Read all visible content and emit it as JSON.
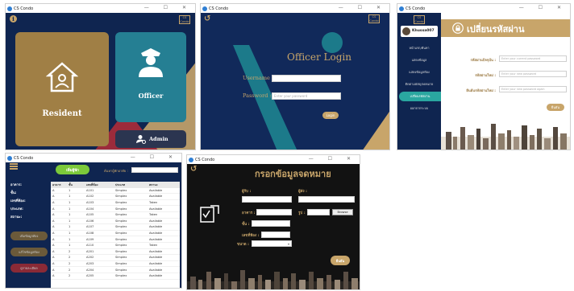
{
  "app_name": "CS Condo",
  "window_controls": "— ☐ ✕",
  "win1": {
    "resident_label": "Resident",
    "officer_label": "Officer",
    "admin_label": "Admin",
    "logo": "CS Condo"
  },
  "win2": {
    "title": "Officer Login",
    "username_label": "Username :",
    "password_label": "Password :",
    "password_placeholder": "Enter your password",
    "login_button": "Login",
    "logo": "CS Condo"
  },
  "win3": {
    "page_title": "เปลี่ยนรหัสผ่าน",
    "username": "Khussa007",
    "logo": "CS Condo",
    "menu": [
      "หน้าแรก/ค้นหา",
      "แสดงข้อมูล",
      "แสดงข้อมูลห้อง",
      "ติดตามพัสดุ/จดหมาย",
      "เปลี่ยนรหัสผ่าน",
      "ออกจากระบบ"
    ],
    "old_password_label": "รหัสผ่านปัจจุบัน :",
    "old_password_placeholder": "Enter your current password",
    "new_password_label": "รหัสผ่านใหม่ :",
    "new_password_placeholder": "Enter your new password",
    "confirm_label": "ยืนยันรหัสผ่านใหม่ :",
    "confirm_placeholder": "Enter your new password again",
    "submit_button": "ยืนยัน"
  },
  "win4": {
    "filter_labels": [
      "อาคาร:",
      "ชั้น:",
      "เลขที่ห้อง:",
      "ประเภท:",
      "สถานะ:"
    ],
    "add_button": "เพิ่มผู้พัก",
    "search_label": "ค้นหาผู้พักอาศัย :",
    "side_buttons": [
      "เพิ่มข้อมูลห้อง",
      "แก้ไขข้อมูลห้อง",
      "ดูรายละเอียด"
    ],
    "columns": [
      "อาคาร",
      "ชั้น",
      "เลขที่ห้อง",
      "ประเภท",
      "สถานะ"
    ],
    "rows": [
      [
        "A",
        "1",
        "A101",
        "Simplex",
        "Available"
      ],
      [
        "A",
        "1",
        "A102",
        "Simplex",
        "Available"
      ],
      [
        "A",
        "1",
        "A103",
        "Simplex",
        "Taken"
      ],
      [
        "A",
        "1",
        "A104",
        "Simplex",
        "Available"
      ],
      [
        "A",
        "1",
        "A105",
        "Simplex",
        "Taken"
      ],
      [
        "A",
        "1",
        "A106",
        "Simplex",
        "Available"
      ],
      [
        "A",
        "1",
        "A107",
        "Simplex",
        "Available"
      ],
      [
        "A",
        "1",
        "A108",
        "Simplex",
        "Available"
      ],
      [
        "A",
        "1",
        "A109",
        "Simplex",
        "Available"
      ],
      [
        "A",
        "1",
        "A110",
        "Simplex",
        "Taken"
      ],
      [
        "A",
        "2",
        "A201",
        "Simplex",
        "Available"
      ],
      [
        "A",
        "2",
        "A202",
        "Simplex",
        "Available"
      ],
      [
        "A",
        "2",
        "A203",
        "Simplex",
        "Available"
      ],
      [
        "A",
        "2",
        "A204",
        "Simplex",
        "Available"
      ],
      [
        "A",
        "2",
        "A205",
        "Simplex",
        "Available"
      ]
    ]
  },
  "win5": {
    "title": "กรอกข้อมูลจดหมาย",
    "to_label": "ผู้รับ :",
    "building_label": "อาคาร :",
    "floor_label": "ชั้น :",
    "room_label": "เลขที่ห้อง :",
    "size_label": "ขนาด :",
    "from_label": "ผู้ส่ง :",
    "image_label": "รูป :",
    "browse_button": "Browse",
    "submit_button": "ยืนยัน"
  }
}
